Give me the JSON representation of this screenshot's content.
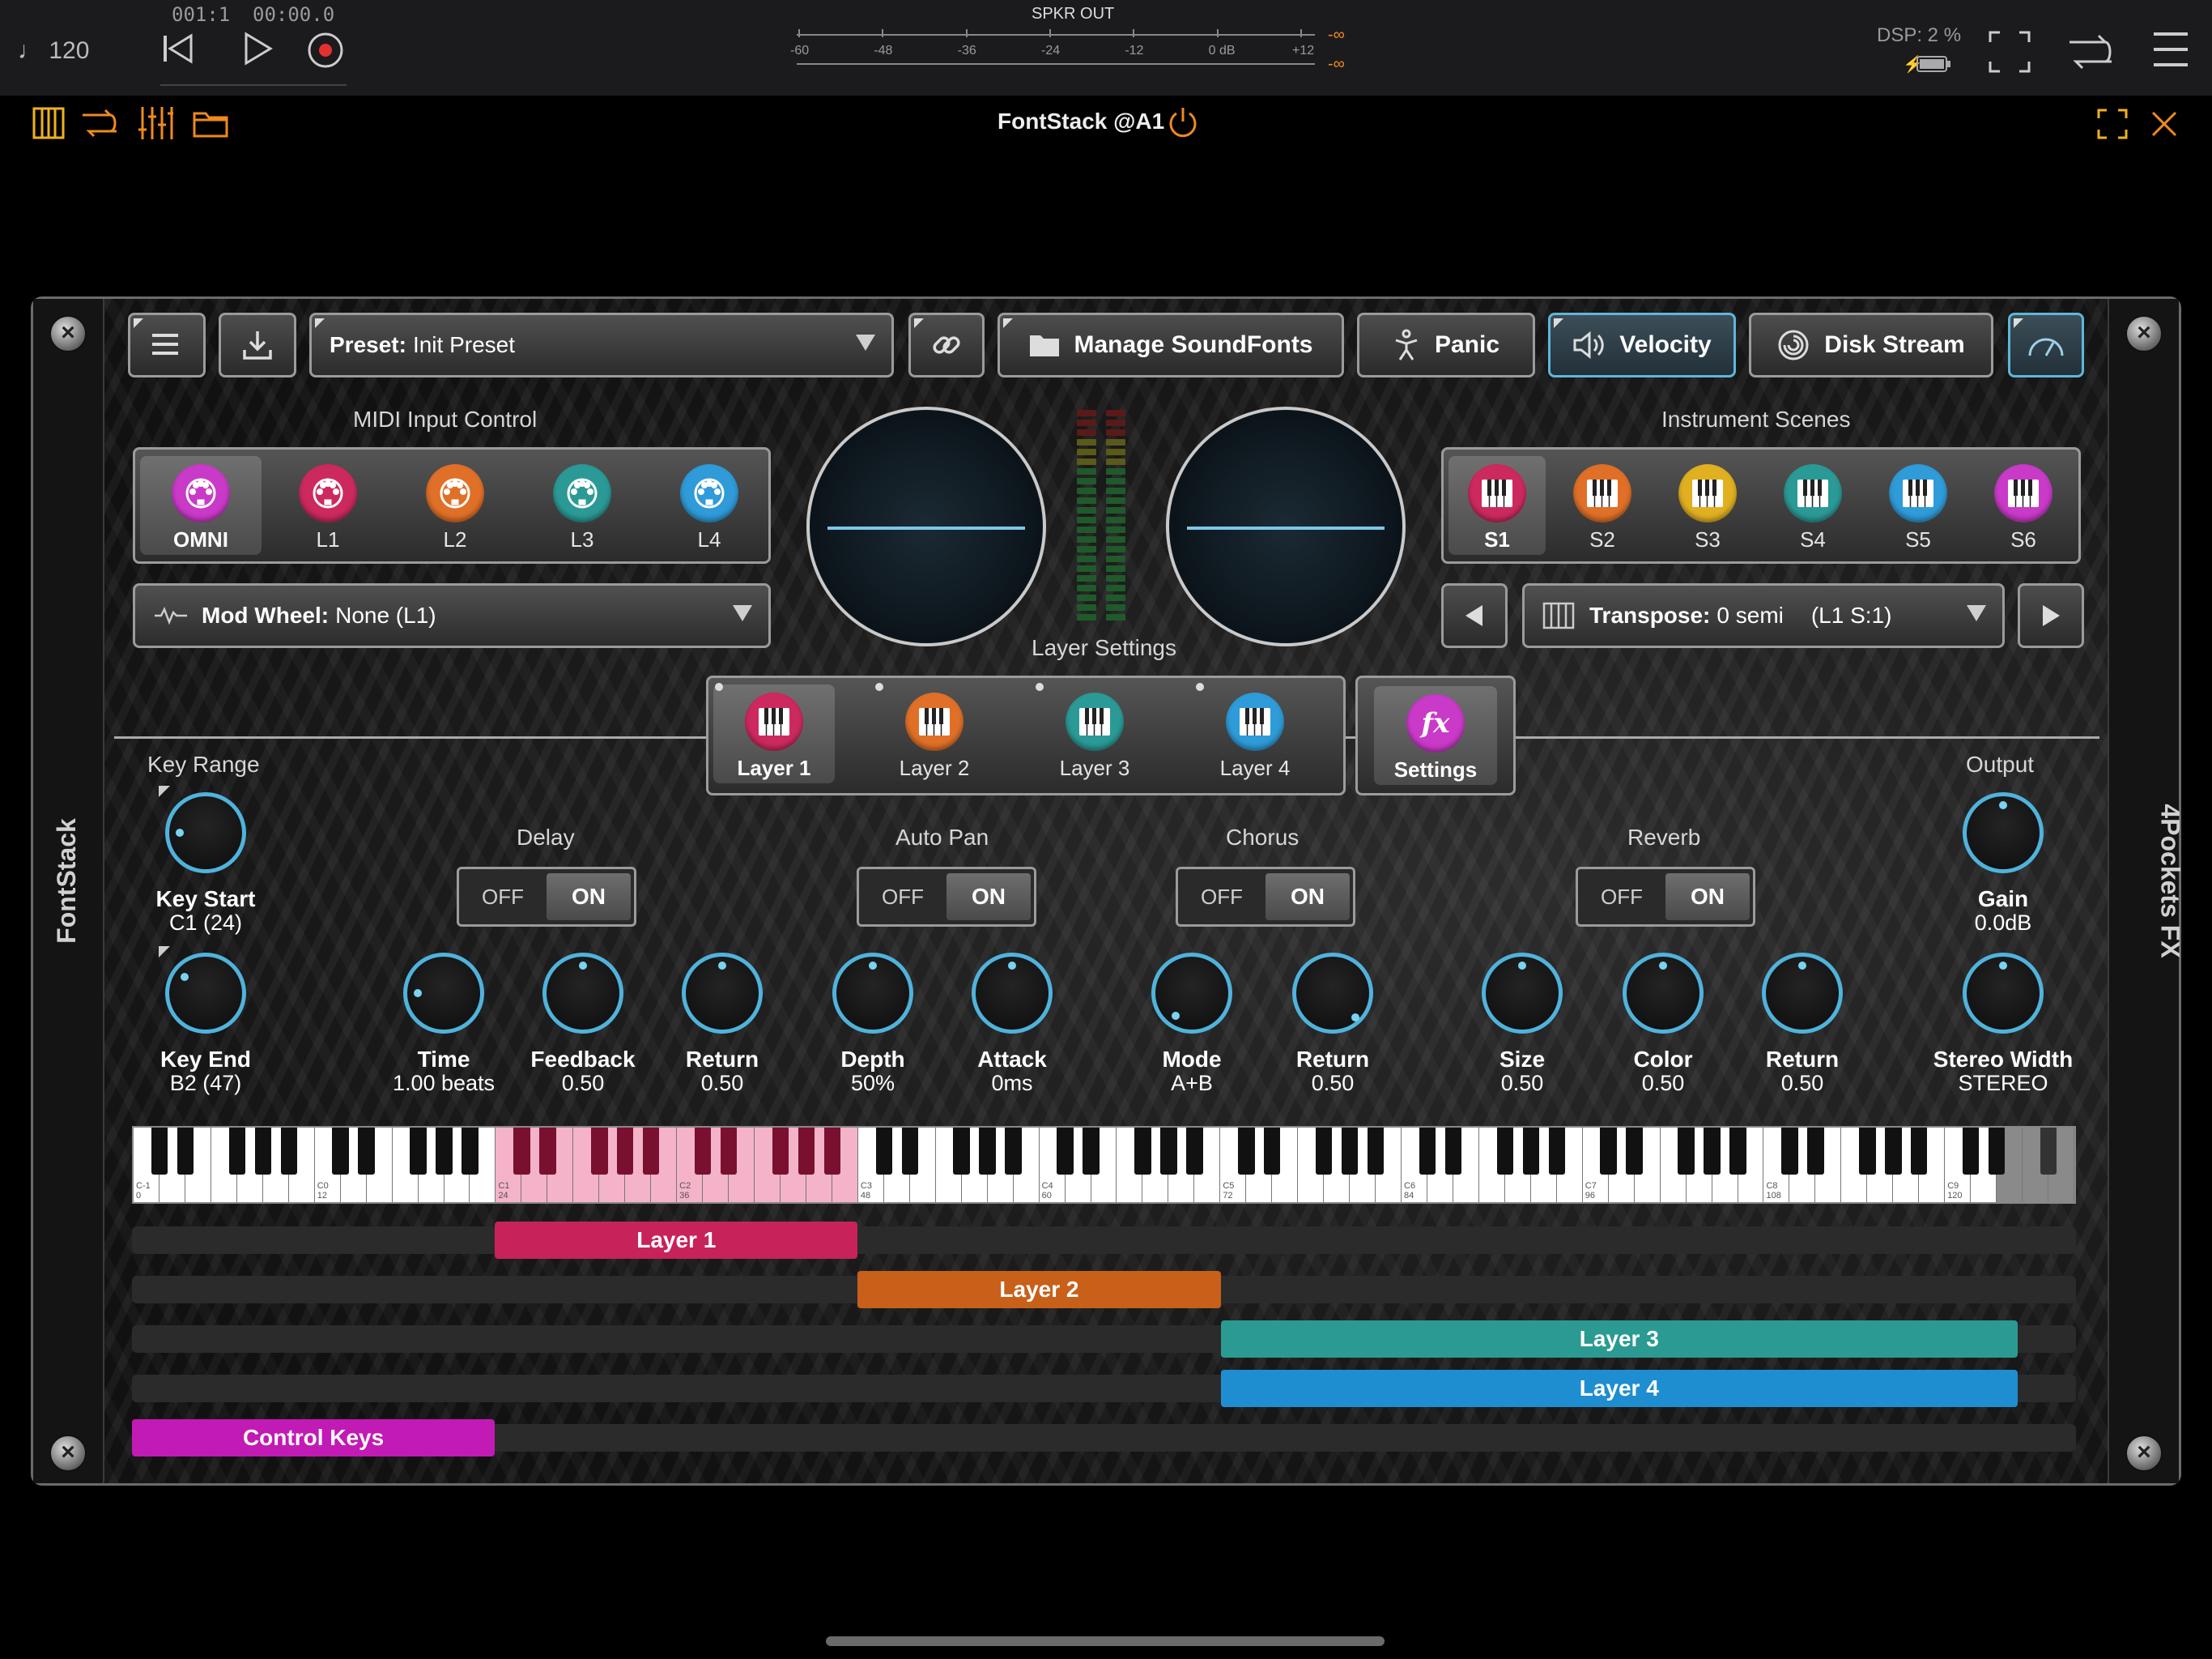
{
  "host": {
    "tempo": "♩ 120",
    "position_bars": "001:1",
    "position_time": "00:00.0",
    "meter_title": "SPKR OUT",
    "meter_scale": [
      "-60",
      "-48",
      "-36",
      "-24",
      "-12",
      "0 dB",
      "+12"
    ],
    "meter_peak_left": "-∞",
    "meter_peak_right": "-∞",
    "dsp": "DSP:  2 %"
  },
  "plugin": {
    "title": "FontStack @A1"
  },
  "panel": {
    "left_label": "FontStack",
    "right_label": "4Pockets FX"
  },
  "toolbar": {
    "preset_label": "Preset:",
    "preset_value": "Init Preset",
    "manage_label": "Manage SoundFonts",
    "panic_label": "Panic",
    "velocity_label": "Velocity",
    "disk_label": "Disk Stream"
  },
  "midi": {
    "title": "MIDI Input Control",
    "channels": [
      {
        "label": "OMNI",
        "color": "#c93ac8",
        "active": true
      },
      {
        "label": "L1",
        "color": "#cc2a5e",
        "active": false
      },
      {
        "label": "L2",
        "color": "#e07028",
        "active": false
      },
      {
        "label": "L3",
        "color": "#2b9a96",
        "active": false
      },
      {
        "label": "L4",
        "color": "#2f9bd8",
        "active": false
      }
    ],
    "mod_label": "Mod Wheel:",
    "mod_value": "None (L1)"
  },
  "scenes": {
    "title": "Instrument Scenes",
    "items": [
      {
        "label": "S1",
        "color": "#cc2a5e",
        "active": true
      },
      {
        "label": "S2",
        "color": "#e07028",
        "active": false
      },
      {
        "label": "S3",
        "color": "#e0b021",
        "active": false
      },
      {
        "label": "S4",
        "color": "#2b9a96",
        "active": false
      },
      {
        "label": "S5",
        "color": "#2f9bd8",
        "active": false
      },
      {
        "label": "S6",
        "color": "#c93ac8",
        "active": false
      }
    ],
    "transpose_label": "Transpose:",
    "transpose_value": "0 semi",
    "transpose_info": "(L1 S:1)"
  },
  "layers": {
    "title": "Layer Settings",
    "tabs": [
      {
        "label": "Layer 1",
        "color": "#cc2a5e",
        "active": true
      },
      {
        "label": "Layer 2",
        "color": "#e07028",
        "active": false
      },
      {
        "label": "Layer 3",
        "color": "#2b9a96",
        "active": false
      },
      {
        "label": "Layer 4",
        "color": "#2f9bd8",
        "active": false
      }
    ],
    "settings_label": "Settings",
    "settings_icon_text": "fx"
  },
  "keyrange": {
    "title": "Key Range",
    "start_label": "Key Start",
    "start_value": "C1 (24)",
    "end_label": "Key End",
    "end_value": "B2 (47)"
  },
  "output": {
    "title": "Output",
    "gain_label": "Gain",
    "gain_value": "0.0dB",
    "width_label": "Stereo Width",
    "width_value": "STEREO"
  },
  "fx": {
    "off": "OFF",
    "on": "ON",
    "delay": {
      "title": "Delay",
      "knobs": [
        {
          "label": "Time",
          "value": "1.00 beats"
        },
        {
          "label": "Feedback",
          "value": "0.50"
        },
        {
          "label": "Return",
          "value": "0.50"
        }
      ]
    },
    "autopan": {
      "title": "Auto Pan",
      "knobs": [
        {
          "label": "Depth",
          "value": "50%"
        },
        {
          "label": "Attack",
          "value": "0ms"
        }
      ]
    },
    "chorus": {
      "title": "Chorus",
      "knobs": [
        {
          "label": "Mode",
          "value": "A+B"
        },
        {
          "label": "Return",
          "value": "0.50"
        }
      ]
    },
    "reverb": {
      "title": "Reverb",
      "knobs": [
        {
          "label": "Size",
          "value": "0.50"
        },
        {
          "label": "Color",
          "value": "0.50"
        },
        {
          "label": "Return",
          "value": "0.50"
        }
      ]
    }
  },
  "keyboard": {
    "octave_labels": [
      {
        "note": "C-1",
        "num": "0"
      },
      {
        "note": "C0",
        "num": "12"
      },
      {
        "note": "C1",
        "num": "24"
      },
      {
        "note": "C2",
        "num": "36"
      },
      {
        "note": "C3",
        "num": "48"
      },
      {
        "note": "C4",
        "num": "60"
      },
      {
        "note": "C5",
        "num": "72"
      },
      {
        "note": "C6",
        "num": "84"
      },
      {
        "note": "C7",
        "num": "96"
      },
      {
        "note": "C8",
        "num": "108"
      },
      {
        "note": "C9",
        "num": "120"
      }
    ],
    "highlight_range": [
      24,
      47
    ],
    "highlight_color": "#f4b3c8"
  },
  "ranges": [
    {
      "label": "Layer 1",
      "start": 24,
      "end": 47,
      "color": "#c8225a"
    },
    {
      "label": "Layer 2",
      "start": 48,
      "end": 71,
      "color": "#c8601a"
    },
    {
      "label": "Layer 3",
      "start": 72,
      "end": 127,
      "color": "#2a9a92"
    },
    {
      "label": "Layer 4",
      "start": 72,
      "end": 127,
      "color": "#1f8ed0"
    },
    {
      "label": "Control Keys",
      "start": 0,
      "end": 23,
      "color": "#c21ab4"
    }
  ]
}
